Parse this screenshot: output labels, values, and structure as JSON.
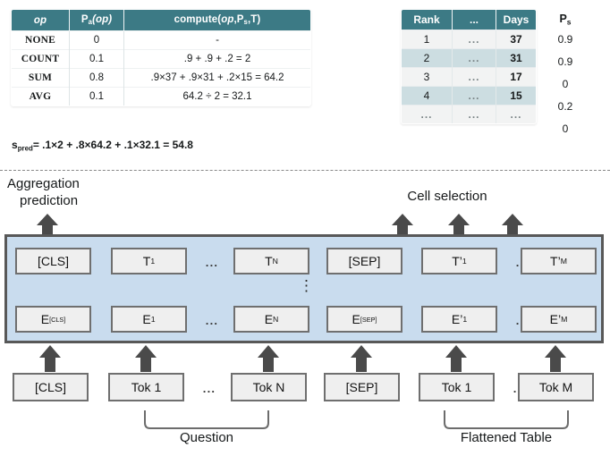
{
  "agg_table": {
    "headers": [
      "op",
      "Pa(op)",
      "compute(op,Ps,T)"
    ],
    "header_parts": {
      "col1": "op",
      "col2_main": "P",
      "col2_sub": "a",
      "col2_rest": "(op)",
      "col3_pre": "compute(",
      "col3_ital": "op",
      "col3_mid": ",P",
      "col3_sub": "s",
      "col3_post": ",T)"
    },
    "rows": [
      {
        "op": "NONE",
        "pa": "0",
        "compute": "-"
      },
      {
        "op": "COUNT",
        "pa": "0.1",
        "compute": ".9 + .9 + .2 = 2"
      },
      {
        "op": "SUM",
        "pa": "0.8",
        "compute": ".9×37 + .9×31 + .2×15 = 64.2"
      },
      {
        "op": "AVG",
        "pa": "0.1",
        "compute": "64.2 ÷ 2 = 32.1"
      }
    ]
  },
  "spred": {
    "symbol": "s",
    "subscript": "pred",
    "equation": "= .1×2 + .8×64.2 + .1×32.1 = 54.8"
  },
  "rank_table": {
    "headers": [
      "Rank",
      "...",
      "Days"
    ],
    "rows": [
      {
        "rank": "1",
        "mid": "...",
        "days": "37"
      },
      {
        "rank": "2",
        "mid": "...",
        "days": "31"
      },
      {
        "rank": "3",
        "mid": "...",
        "days": "17"
      },
      {
        "rank": "4",
        "mid": "...",
        "days": "15"
      },
      {
        "rank": "...",
        "mid": "...",
        "days": "..."
      }
    ]
  },
  "ps_column": {
    "header_main": "P",
    "header_sub": "s",
    "values": [
      "0.9",
      "0.9",
      "0",
      "0.2",
      "0"
    ]
  },
  "labels": {
    "aggregation_line1": "Aggregation",
    "aggregation_line2": "prediction",
    "cell_selection": "Cell selection",
    "question": "Question",
    "flattened_table": "Flattened Table"
  },
  "transformer": {
    "vertical_dots": "⋮",
    "output_row": [
      {
        "main": "[CLS]",
        "sub": "",
        "prime": false
      },
      {
        "main": "T",
        "sub": "1",
        "prime": false
      },
      {
        "main": "T",
        "sub": "N",
        "prime": false
      },
      {
        "main": "[SEP]",
        "sub": "",
        "prime": false
      },
      {
        "main": "T",
        "sub": "1",
        "prime": true
      },
      {
        "main": "T",
        "sub": "M",
        "prime": true
      }
    ],
    "embedding_row": [
      {
        "main": "E",
        "sub": "[CLS]",
        "prime": false
      },
      {
        "main": "E",
        "sub": "1",
        "prime": false
      },
      {
        "main": "E",
        "sub": "N",
        "prime": false
      },
      {
        "main": "E",
        "sub": "[SEP]",
        "prime": false
      },
      {
        "main": "E",
        "sub": "1",
        "prime": true
      },
      {
        "main": "E",
        "sub": "M",
        "prime": true
      }
    ],
    "ellipsis": "..."
  },
  "token_row": {
    "tokens": [
      "[CLS]",
      "Tok 1",
      "Tok N",
      "[SEP]",
      "Tok 1",
      "Tok M"
    ],
    "ellipsis": "..."
  },
  "colors": {
    "table_header_teal": "#3c7a85",
    "row_stripe_blue": "#ccdde1",
    "row_stripe_gray": "#f2f3f3",
    "transformer_fill": "#c9dcee",
    "transformer_border": "#585858",
    "cell_fill": "#efefef",
    "cell_border": "#6f6f6f",
    "arrow_fill": "#4a4a4a"
  }
}
